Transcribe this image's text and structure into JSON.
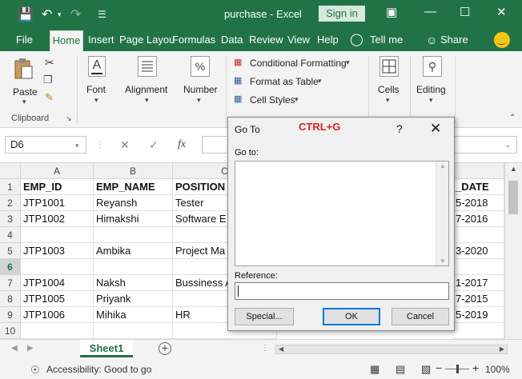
{
  "titlebar": {
    "title": "purchase  -  Excel",
    "signin_label": "Sign in"
  },
  "tabs": {
    "file": "File",
    "home": "Home",
    "insert": "Insert",
    "page_layout": "Page Layou",
    "formulas": "Formulas",
    "data": "Data",
    "review": "Review",
    "view": "View",
    "help": "Help",
    "tell_me": "Tell me",
    "share": "Share"
  },
  "ribbon": {
    "paste": "Paste",
    "clipboard": "Clipboard",
    "font": "Font",
    "alignment": "Alignment",
    "number": "Number",
    "conditional_formatting": "Conditional Formatting",
    "format_as_table": "Format as Table",
    "cell_styles": "Cell Styles",
    "cells": "Cells",
    "editing": "Editing"
  },
  "formula_bar": {
    "name_box": "D6",
    "fx": "fx"
  },
  "grid": {
    "columns": [
      "A",
      "B",
      "C"
    ],
    "rows": [
      {
        "num": "1",
        "a": "EMP_ID",
        "b": "EMP_NAME",
        "c": "POSITION",
        "right": "_DATE"
      },
      {
        "num": "2",
        "a": "JTP1001",
        "b": "Reyansh",
        "c": "Tester",
        "right": "5-2018"
      },
      {
        "num": "3",
        "a": "JTP1002",
        "b": "Himakshi",
        "c": "Software E",
        "right": "7-2016"
      },
      {
        "num": "4",
        "a": "",
        "b": "",
        "c": "",
        "right": ""
      },
      {
        "num": "5",
        "a": "JTP1003",
        "b": "Ambika",
        "c": "Project Ma",
        "right": "3-2020"
      },
      {
        "num": "6",
        "a": "",
        "b": "",
        "c": "",
        "right": ""
      },
      {
        "num": "7",
        "a": "JTP1004",
        "b": "Naksh",
        "c": "Bussiness A",
        "right": "1-2017"
      },
      {
        "num": "8",
        "a": "JTP1005",
        "b": "Priyank",
        "c": "",
        "right": "7-2015"
      },
      {
        "num": "9",
        "a": "JTP1006",
        "b": "Mihika",
        "c": "HR",
        "right": "5-2019"
      },
      {
        "num": "10",
        "a": "",
        "b": "",
        "c": "",
        "right": ""
      }
    ]
  },
  "sheets": {
    "active": "Sheet1"
  },
  "statusbar": {
    "accessibility": "Accessibility: Good to go",
    "zoom": "100%"
  },
  "dialog": {
    "title": "Go To",
    "shortcut": "CTRL+G",
    "help": "?",
    "goto_label": "Go to:",
    "reference_label": "Reference:",
    "reference_value": "",
    "special_button": "Special...",
    "ok_button": "OK",
    "cancel_button": "Cancel"
  },
  "colors": {
    "excel_green": "#217346",
    "shortcut_red": "#e02020",
    "focus_blue": "#0078d7"
  }
}
